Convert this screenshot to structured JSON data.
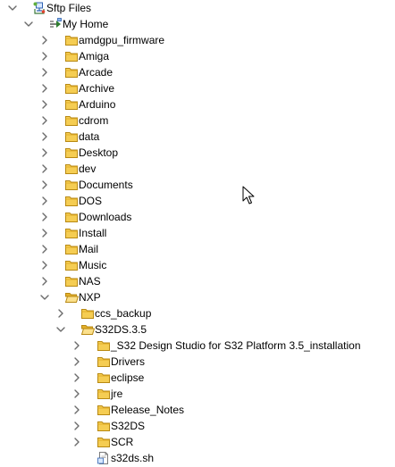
{
  "colors": {
    "chevron": "#6b6b6b",
    "folder_fill": "#f5cd53",
    "folder_tab": "#e4b02a",
    "folder_stroke": "#b88913",
    "folder_open_front": "#fbe08c"
  },
  "tree": [
    {
      "label": "Sftp Files",
      "depth": 0,
      "expanded": true,
      "icon": "sftp-files-icon"
    },
    {
      "label": "My Home",
      "depth": 1,
      "expanded": true,
      "icon": "my-home-icon"
    },
    {
      "label": "amdgpu_firmware",
      "depth": 2,
      "expanded": false,
      "icon": "folder-icon"
    },
    {
      "label": "Amiga",
      "depth": 2,
      "expanded": false,
      "icon": "folder-icon"
    },
    {
      "label": "Arcade",
      "depth": 2,
      "expanded": false,
      "icon": "folder-icon"
    },
    {
      "label": "Archive",
      "depth": 2,
      "expanded": false,
      "icon": "folder-icon"
    },
    {
      "label": "Arduino",
      "depth": 2,
      "expanded": false,
      "icon": "folder-icon"
    },
    {
      "label": "cdrom",
      "depth": 2,
      "expanded": false,
      "icon": "folder-icon"
    },
    {
      "label": "data",
      "depth": 2,
      "expanded": false,
      "icon": "folder-icon"
    },
    {
      "label": "Desktop",
      "depth": 2,
      "expanded": false,
      "icon": "folder-icon"
    },
    {
      "label": "dev",
      "depth": 2,
      "expanded": false,
      "icon": "folder-icon"
    },
    {
      "label": "Documents",
      "depth": 2,
      "expanded": false,
      "icon": "folder-icon"
    },
    {
      "label": "DOS",
      "depth": 2,
      "expanded": false,
      "icon": "folder-icon"
    },
    {
      "label": "Downloads",
      "depth": 2,
      "expanded": false,
      "icon": "folder-icon"
    },
    {
      "label": "Install",
      "depth": 2,
      "expanded": false,
      "icon": "folder-icon"
    },
    {
      "label": "Mail",
      "depth": 2,
      "expanded": false,
      "icon": "folder-icon"
    },
    {
      "label": "Music",
      "depth": 2,
      "expanded": false,
      "icon": "folder-icon"
    },
    {
      "label": "NAS",
      "depth": 2,
      "expanded": false,
      "icon": "folder-icon"
    },
    {
      "label": "NXP",
      "depth": 2,
      "expanded": true,
      "icon": "folder-open-icon"
    },
    {
      "label": "ccs_backup",
      "depth": 3,
      "expanded": false,
      "icon": "folder-icon"
    },
    {
      "label": "S32DS.3.5",
      "depth": 3,
      "expanded": true,
      "icon": "folder-open-icon"
    },
    {
      "label": "_S32 Design Studio for S32 Platform 3.5_installation",
      "depth": 4,
      "expanded": false,
      "icon": "folder-icon"
    },
    {
      "label": "Drivers",
      "depth": 4,
      "expanded": false,
      "icon": "folder-icon"
    },
    {
      "label": "eclipse",
      "depth": 4,
      "expanded": false,
      "icon": "folder-icon"
    },
    {
      "label": "jre",
      "depth": 4,
      "expanded": false,
      "icon": "folder-icon"
    },
    {
      "label": "Release_Notes",
      "depth": 4,
      "expanded": false,
      "icon": "folder-icon"
    },
    {
      "label": "S32DS",
      "depth": 4,
      "expanded": false,
      "icon": "folder-icon"
    },
    {
      "label": "SCR",
      "depth": 4,
      "expanded": false,
      "icon": "folder-icon"
    },
    {
      "label": "s32ds.sh",
      "depth": 4,
      "expanded": null,
      "icon": "shell-script-file-icon"
    }
  ]
}
